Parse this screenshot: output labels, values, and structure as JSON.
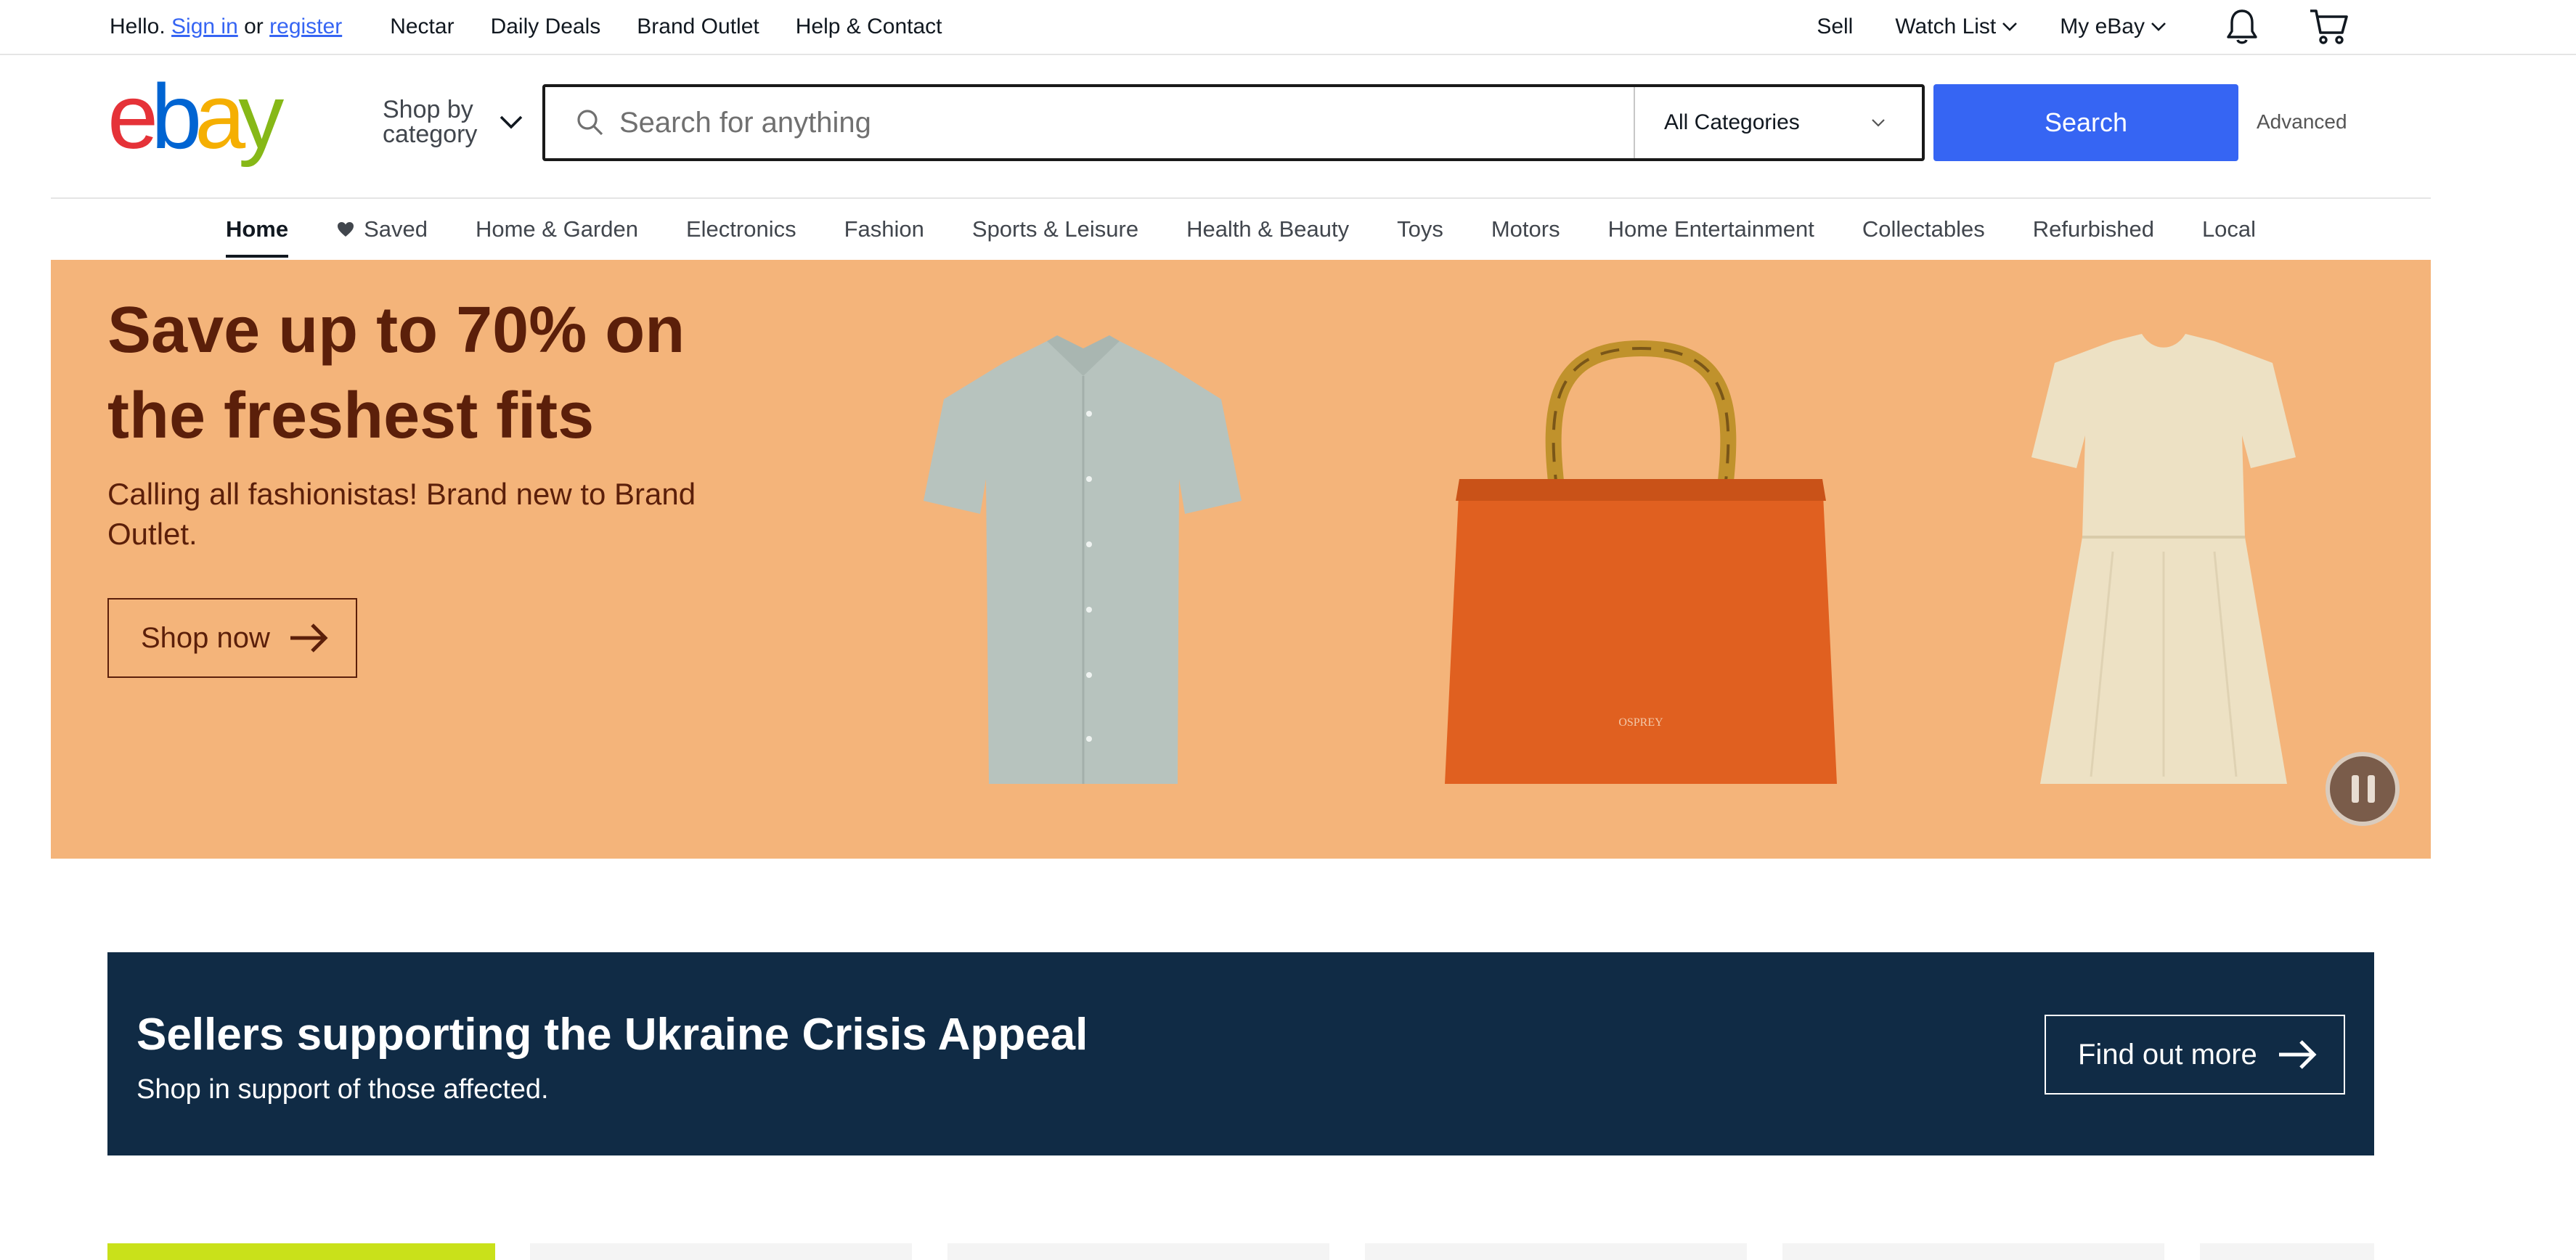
{
  "topbar": {
    "greeting": "Hello.",
    "sign_in": "Sign in",
    "or": "or",
    "register": "register",
    "links": [
      "Nectar",
      "Daily Deals",
      "Brand Outlet",
      "Help & Contact"
    ],
    "sell": "Sell",
    "watch_list": "Watch List",
    "my_ebay": "My eBay"
  },
  "header": {
    "logo_text": "ebay",
    "shop_by_category": "Shop by category",
    "search_placeholder": "Search for anything",
    "category_select": "All Categories",
    "search_button": "Search",
    "advanced": "Advanced"
  },
  "nav": {
    "items": [
      "Home",
      "Saved",
      "Home & Garden",
      "Electronics",
      "Fashion",
      "Sports & Leisure",
      "Health & Beauty",
      "Toys",
      "Motors",
      "Home Entertainment",
      "Collectables",
      "Refurbished",
      "Local"
    ]
  },
  "hero": {
    "title": "Save up to 70% on the freshest fits",
    "subtitle": "Calling all fashionistas! Brand new to Brand Outlet.",
    "cta": "Shop now",
    "bag_brand": "OSPREY"
  },
  "ukraine": {
    "title": "Sellers supporting the Ukraine Crisis Appeal",
    "subtitle": "Shop in support of those affected.",
    "cta": "Find out more"
  },
  "colors": {
    "brand_blue": "#3665f3",
    "hero_bg": "#f4b47a",
    "hero_text": "#5b1f0a",
    "banner_bg": "#102b45",
    "logo_red": "#e53238",
    "logo_blue": "#0064d2",
    "logo_yellow": "#f5af02",
    "logo_green": "#86b817"
  }
}
